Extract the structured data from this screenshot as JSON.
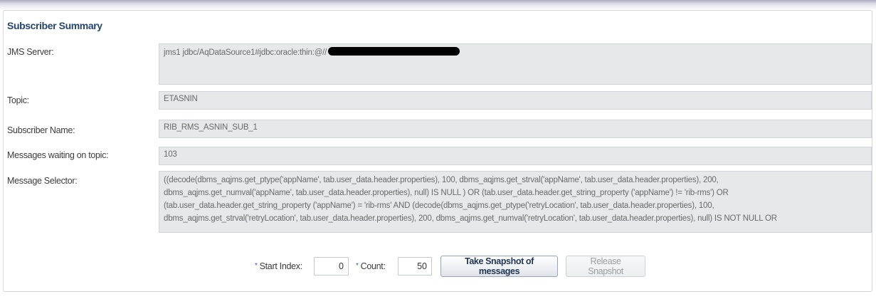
{
  "section": {
    "title": "Subscriber Summary"
  },
  "fields": {
    "jms_server": {
      "label": "JMS Server:",
      "value": "jms1  jdbc/AqDataSource1#jdbc:oracle:thin:@//"
    },
    "topic": {
      "label": "Topic:",
      "value": "ETASNIN"
    },
    "subscriber_name": {
      "label": "Subscriber Name:",
      "value": "RIB_RMS_ASNIN_SUB_1"
    },
    "messages_waiting": {
      "label": "Messages waiting on topic:",
      "value": "103"
    },
    "message_selector": {
      "label": "Message Selector:",
      "value": "((decode(dbms_aqjms.get_ptype('appName', tab.user_data.header.properties), 100, dbms_aqjms.get_strval('appName', tab.user_data.header.properties), 200,\ndbms_aqjms.get_numval('appName', tab.user_data.header.properties), null) IS  NULL ) OR (tab.user_data.header.get_string_property ('appName')  != 'rib-rms') OR\n(tab.user_data.header.get_string_property ('appName')  = 'rib-rms' AND (decode(dbms_aqjms.get_ptype('retryLocation', tab.user_data.header.properties), 100,\ndbms_aqjms.get_strval('retryLocation', tab.user_data.header.properties), 200, dbms_aqjms.get_numval('retryLocation', tab.user_data.header.properties), null) IS  NOT  NULL  OR"
    }
  },
  "controls": {
    "start_index": {
      "required_mark": "*",
      "label": "Start Index:",
      "value": "0"
    },
    "count": {
      "required_mark": "*",
      "label": "Count:",
      "value": "50"
    },
    "take_snapshot_label": "Take Snapshot of messages",
    "release_snapshot_label": "Release Snapshot"
  },
  "colors": {
    "title": "#25476f",
    "field_background": "#e6e8ea",
    "required_mark": "#2f63a6"
  }
}
